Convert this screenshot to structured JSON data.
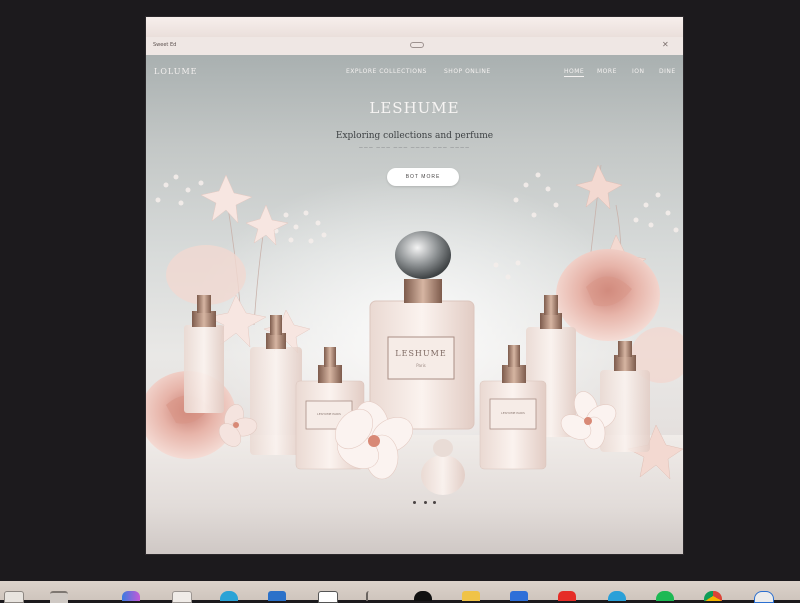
{
  "browser": {
    "tab_label": "Sweet Ed",
    "window_icon": "window-control-icon"
  },
  "site": {
    "logo": "LOLUME",
    "nav": {
      "explore": "EXPLORE COLLECTIONS",
      "shop": "SHOP ONLINE",
      "home": "HOME",
      "more": "MORE",
      "p1": "ION",
      "p2": "DINE"
    },
    "hero": {
      "title": "LESHUME",
      "subtitle": "Exploring collections and perfume",
      "tagline": "——— ——— ——— ———— ——— ————",
      "cta": "BOT MORE"
    },
    "products": {
      "main_label": "LESHUME",
      "main_sub": "Paris",
      "left_label": "LESHUME PARIS",
      "right_label": "LESHUME PARIS"
    },
    "carousel": {
      "slides": 3,
      "active": 1
    }
  },
  "taskbar": {
    "items": [
      "file-explorer-icon",
      "calendar-icon",
      "copilot-icon",
      "store-icon",
      "teams-icon",
      "app-icon",
      "terminal-icon",
      "tiktok-icon",
      "folder-icon",
      "grid-app-icon",
      "youtube-icon",
      "telegram-icon",
      "spotify-icon",
      "chrome-icon",
      "edge-icon"
    ]
  },
  "colors": {
    "accent_rose": "#e9b9ad",
    "bottle_gold": "#b58a74",
    "background": "#1c1a1d"
  }
}
